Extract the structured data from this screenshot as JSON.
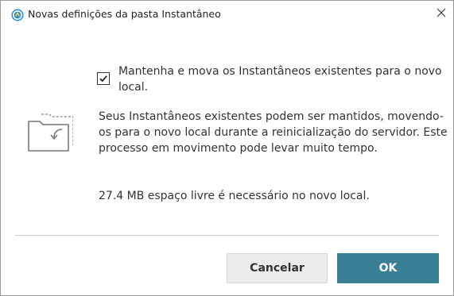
{
  "window": {
    "title": "Novas definições da pasta Instantâneo",
    "app_icon": "app-logo-icon",
    "close_icon": "close-icon"
  },
  "content": {
    "illustration_icon": "folder-move-icon",
    "checkbox": {
      "checked": true,
      "label": "Mantenha e mova os Instantâneos existentes para o novo local."
    },
    "description": "Seus Instantâneos existentes podem ser mantidos, movendo-os para o novo local durante a reinicialização do servidor. Este processo em movimento pode levar muito tempo.",
    "space_note": "27.4 MB espaço livre é necessário no novo local."
  },
  "footer": {
    "cancel_label": "Cancelar",
    "ok_label": "OK"
  },
  "colors": {
    "primary_button": "#3b7f96",
    "secondary_button": "#ececec",
    "text": "#333333"
  }
}
